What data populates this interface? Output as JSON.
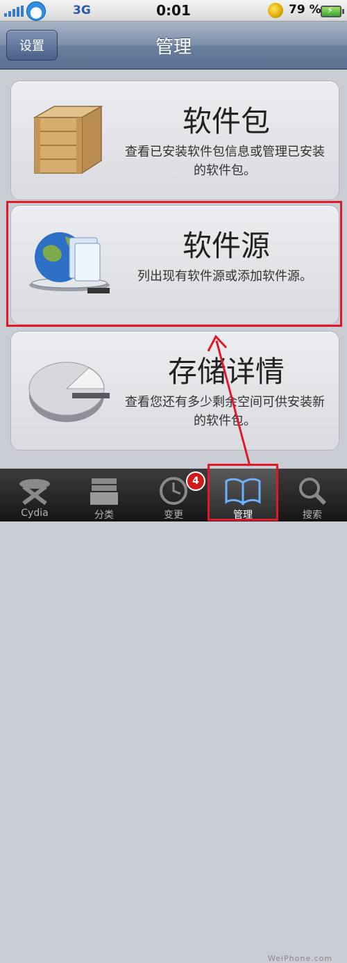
{
  "status_bar": {
    "network": "3G",
    "time": "0:01",
    "battery_percent": "79 %"
  },
  "nav": {
    "back_label": "设置",
    "title": "管理"
  },
  "cards": [
    {
      "title": "软件包",
      "description": "查看已安装软件包信息或管理已安装的软件包。",
      "icon": "wooden-box-icon"
    },
    {
      "title": "软件源",
      "description": "列出现有软件源或添加软件源。",
      "icon": "globe-folder-icon"
    },
    {
      "title": "存储详情",
      "description": "查看您还有多少剩余空间可供安装新的软件包。",
      "icon": "pie-chart-icon"
    }
  ],
  "tabs": [
    {
      "label": "Cydia",
      "icon": "cydia-icon"
    },
    {
      "label": "分类",
      "icon": "sections-icon"
    },
    {
      "label": "变更",
      "icon": "clock-icon",
      "badge": "4"
    },
    {
      "label": "管理",
      "icon": "book-icon",
      "active": true
    },
    {
      "label": "搜索",
      "icon": "search-icon"
    }
  ],
  "watermark": "WeiPhone.com",
  "colors": {
    "highlight": "#e0182a",
    "navbar": "#6b7f9e"
  }
}
